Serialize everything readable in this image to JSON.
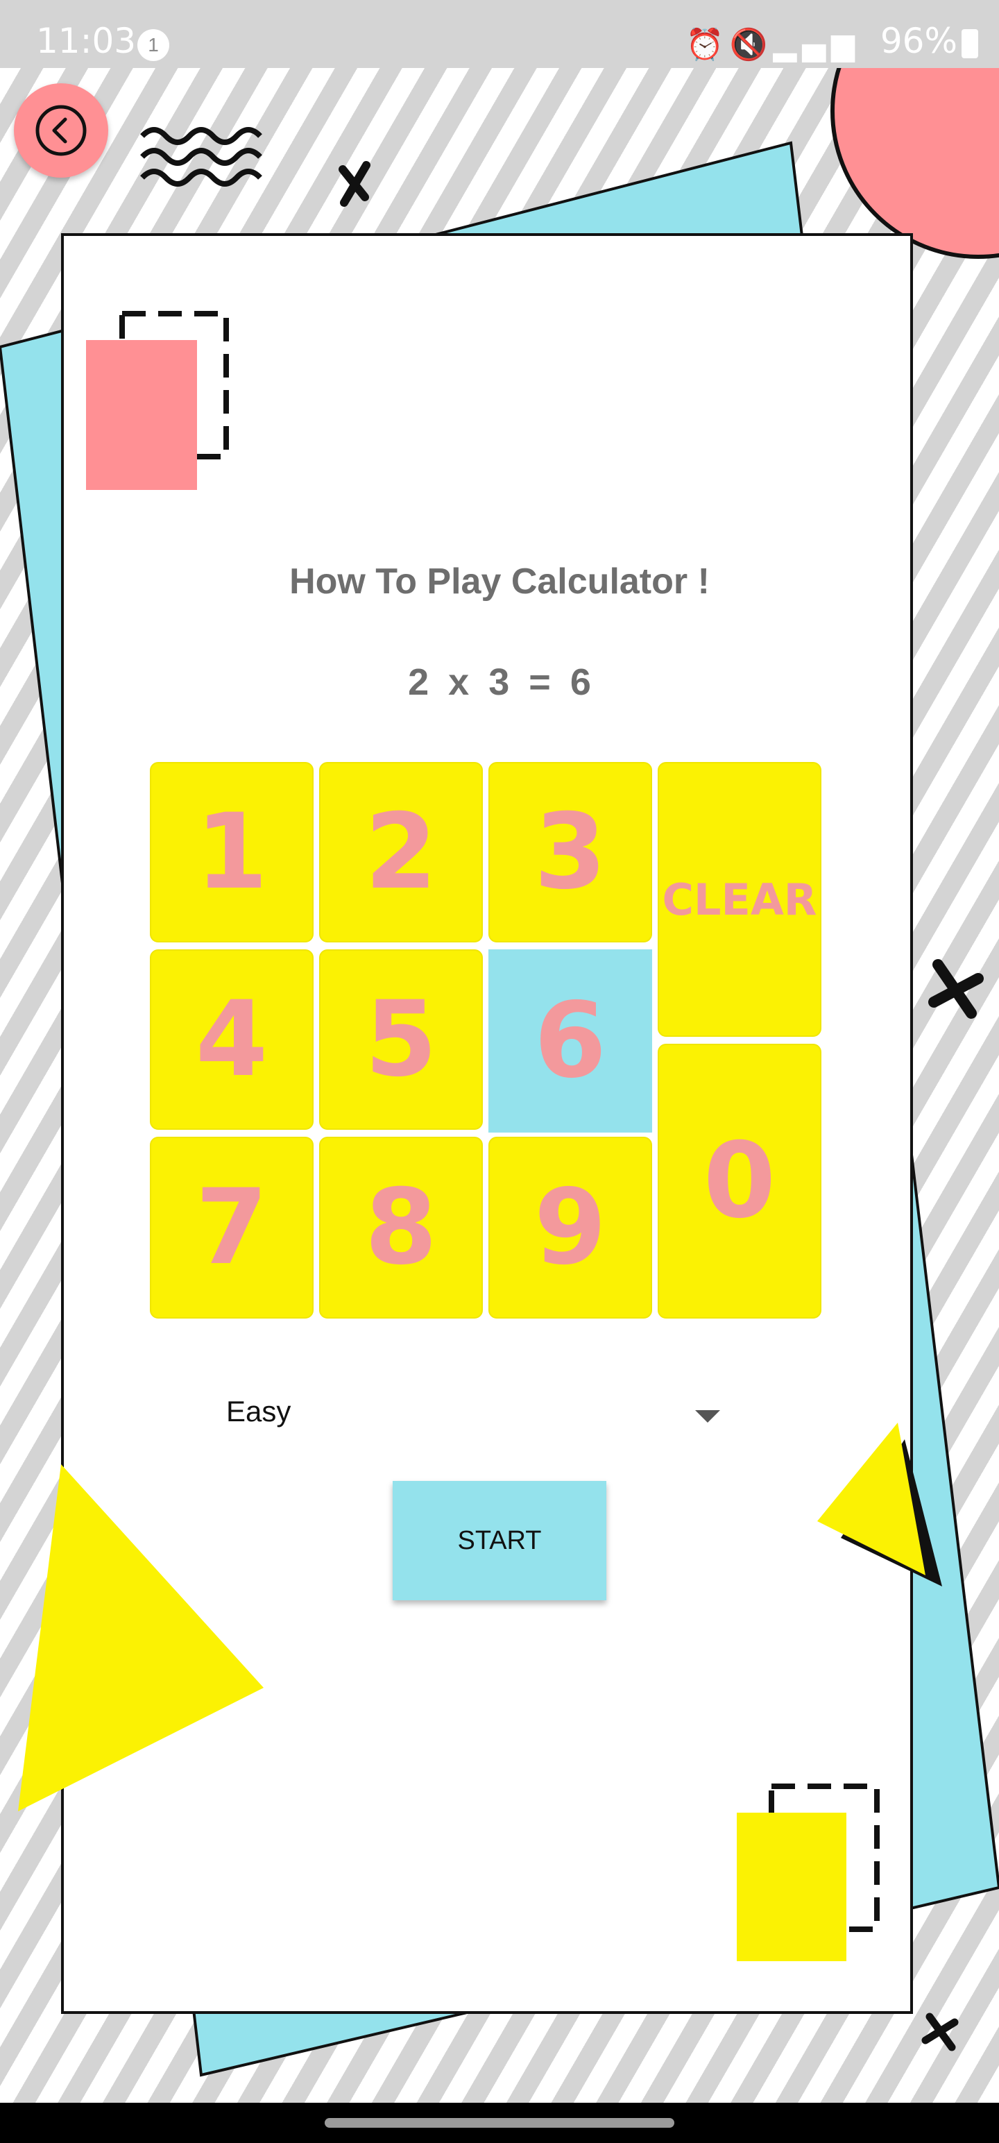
{
  "status_bar": {
    "time": "11:03",
    "notification_count": "1",
    "battery": "96%",
    "icons": [
      "alarm-icon",
      "mute-icon",
      "volte-icon",
      "signal-icon",
      "signal-icon",
      "battery-icon"
    ]
  },
  "title": "How To Play Calculator !",
  "example": {
    "left": "2",
    "op": "x",
    "right": "3",
    "eq": "=",
    "result": "6"
  },
  "keypad": {
    "keys": [
      "1",
      "2",
      "3",
      "4",
      "5",
      "6",
      "7",
      "8",
      "9"
    ],
    "clear": "CLEAR",
    "zero": "0",
    "highlighted": "6"
  },
  "difficulty": {
    "selected": "Easy"
  },
  "start_label": "START",
  "colors": {
    "pink": "#ff9094",
    "yellow": "#fbf203",
    "cyan": "#94e2ec",
    "number_pink": "#f3999c",
    "text_gray": "#6e6e6e",
    "stripe_gray": "#d4d4d4"
  }
}
